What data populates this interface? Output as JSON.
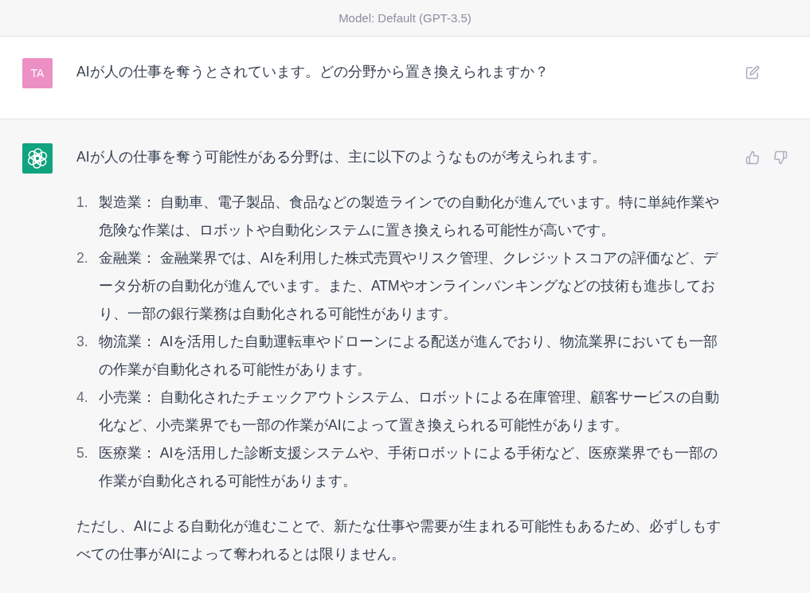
{
  "header": {
    "model_label": "Model: Default (GPT-3.5)"
  },
  "messages": [
    {
      "kind": "user",
      "avatar_text": "TA",
      "blocks": [
        {
          "kind": "paragraph",
          "text": "AIが人の仕事を奪うとされています。どの分野から置き換えられますか？"
        }
      ]
    },
    {
      "kind": "assistant",
      "blocks": [
        {
          "kind": "paragraph",
          "text": "AIが人の仕事を奪う可能性がある分野は、主に以下のようなものが考えられます。"
        },
        {
          "kind": "list",
          "items": [
            {
              "number": "1.",
              "text": "製造業： 自動車、電子製品、食品などの製造ラインでの自動化が進んでいます。特に単純作業や危険な作業は、ロボットや自動化システムに置き換えられる可能性が高いです。"
            },
            {
              "number": "2.",
              "text": "金融業： 金融業界では、AIを利用した株式売買やリスク管理、クレジットスコアの評価など、データ分析の自動化が進んでいます。また、ATMやオンラインバンキングなどの技術も進歩しており、一部の銀行業務は自動化される可能性があります。"
            },
            {
              "number": "3.",
              "text": "物流業： AIを活用した自動運転車やドローンによる配送が進んでおり、物流業界においても一部の作業が自動化される可能性があります。"
            },
            {
              "number": "4.",
              "text": "小売業： 自動化されたチェックアウトシステム、ロボットによる在庫管理、顧客サービスの自動化など、小売業界でも一部の作業がAIによって置き換えられる可能性があります。"
            },
            {
              "number": "5.",
              "text": "医療業： AIを活用した診断支援システムや、手術ロボットによる手術など、医療業界でも一部の作業が自動化される可能性があります。"
            }
          ]
        },
        {
          "kind": "paragraph",
          "text": "ただし、AIによる自動化が進むことで、新たな仕事や需要が生まれる可能性もあるため、必ずしもすべての仕事がAIによって奪われるとは限りません。"
        }
      ]
    }
  ]
}
